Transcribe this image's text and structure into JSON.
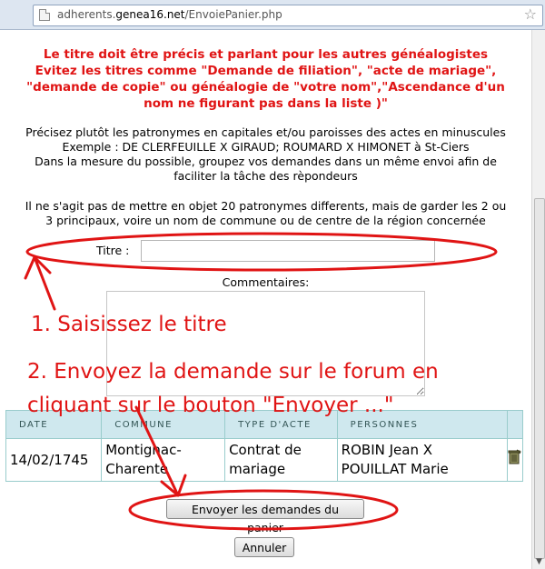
{
  "browser": {
    "url_prefix": "adherents.",
    "url_domain": "genea16.net",
    "url_path": "/EnvoiePanier.php",
    "page_icon": "page-icon",
    "star_icon": "star-icon"
  },
  "warning": {
    "line1": "Le titre doit être précis et parlant pour les autres généalogistes",
    "line2": "Evitez les titres comme \"Demande de filiation\", \"acte de mariage\",",
    "line3": "\"demande de copie\" ou généalogie de \"votre nom\",\"Ascendance d'un",
    "line4": "nom ne figurant pas dans la liste )\""
  },
  "info": {
    "line1": "Précisez plutôt les patronymes en capitales et/ou paroisses des actes en minuscules",
    "line2": "Exemple : DE CLERFEUILLE X GIRAUD; ROUMARD X HIMONET à St-Ciers",
    "line3": "Dans la mesure du possible, groupez vos demandes dans un même envoi afin de",
    "line4": "faciliter la tâche des rèpondeurs",
    "line5": "Il ne s'agit pas de mettre en objet 20 patronymes differents, mais de garder les 2 ou",
    "line6": "3 principaux, voire un nom de commune ou de centre de la région concernée"
  },
  "form": {
    "titre_label": "Titre :",
    "titre_value": "",
    "commentaires_label": "Commentaires:",
    "commentaires_value": ""
  },
  "table": {
    "headers": [
      "DATE",
      "COMMUNE",
      "TYPE D'ACTE",
      "PERSONNES",
      ""
    ],
    "rows": [
      {
        "date": "14/02/1745",
        "commune_line1": "Montignac-",
        "commune_line2": "Charente",
        "type_line1": "Contrat de",
        "type_line2": "mariage",
        "personnes_line1": "ROBIN Jean X",
        "personnes_line2": "POUILLAT Marie",
        "action_icon": "trash-icon"
      }
    ]
  },
  "buttons": {
    "send": "Envoyer les demandes du panier",
    "cancel": "Annuler"
  },
  "annotations": {
    "step1": "1. Saisissez le titre",
    "step2_line1": "2. Envoyez la demande sur le forum en",
    "step2_line2": "cliquant  sur le bouton \"Envoyer ...\"",
    "color": "#e01414"
  }
}
